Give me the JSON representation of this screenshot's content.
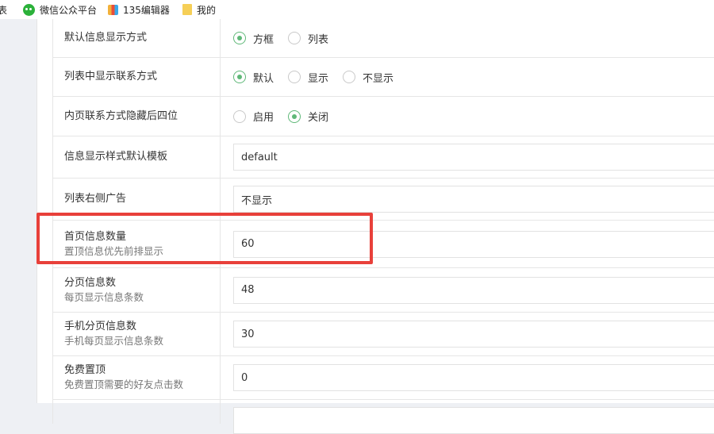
{
  "bookmarks": [
    {
      "label": "表",
      "icon": "none"
    },
    {
      "label": "微信公众平台",
      "icon": "wechat-icon"
    },
    {
      "label": "135编辑器",
      "icon": "app-135-icon"
    },
    {
      "label": "我的",
      "icon": "folder-icon"
    }
  ],
  "rows": {
    "display_mode": {
      "label": "默认信息显示方式",
      "options": [
        "方框",
        "列表"
      ],
      "selected": "方框"
    },
    "list_contact": {
      "label": "列表中显示联系方式",
      "options": [
        "默认",
        "显示",
        "不显示"
      ],
      "selected": "默认"
    },
    "hide_last4": {
      "label": "内页联系方式隐藏后四位",
      "options": [
        "启用",
        "关闭"
      ],
      "selected": "关闭"
    },
    "template": {
      "label": "信息显示样式默认模板",
      "value": "default"
    },
    "list_ad": {
      "label": "列表右侧广告",
      "value": "不显示"
    },
    "home_count": {
      "label": "首页信息数量",
      "sublabel": "置顶信息优先前排显示",
      "value": "60"
    },
    "page_count": {
      "label": "分页信息数",
      "sublabel": "每页显示信息条数",
      "value": "48"
    },
    "mobile_page_count": {
      "label": "手机分页信息数",
      "sublabel": "手机每页显示信息条数",
      "value": "30"
    },
    "free_top": {
      "label": "免费置顶",
      "sublabel": "免费置顶需要的好友点击数",
      "value": "0"
    }
  },
  "colors": {
    "radio_checked": "#5fb878",
    "highlight_border": "#e8403a"
  }
}
